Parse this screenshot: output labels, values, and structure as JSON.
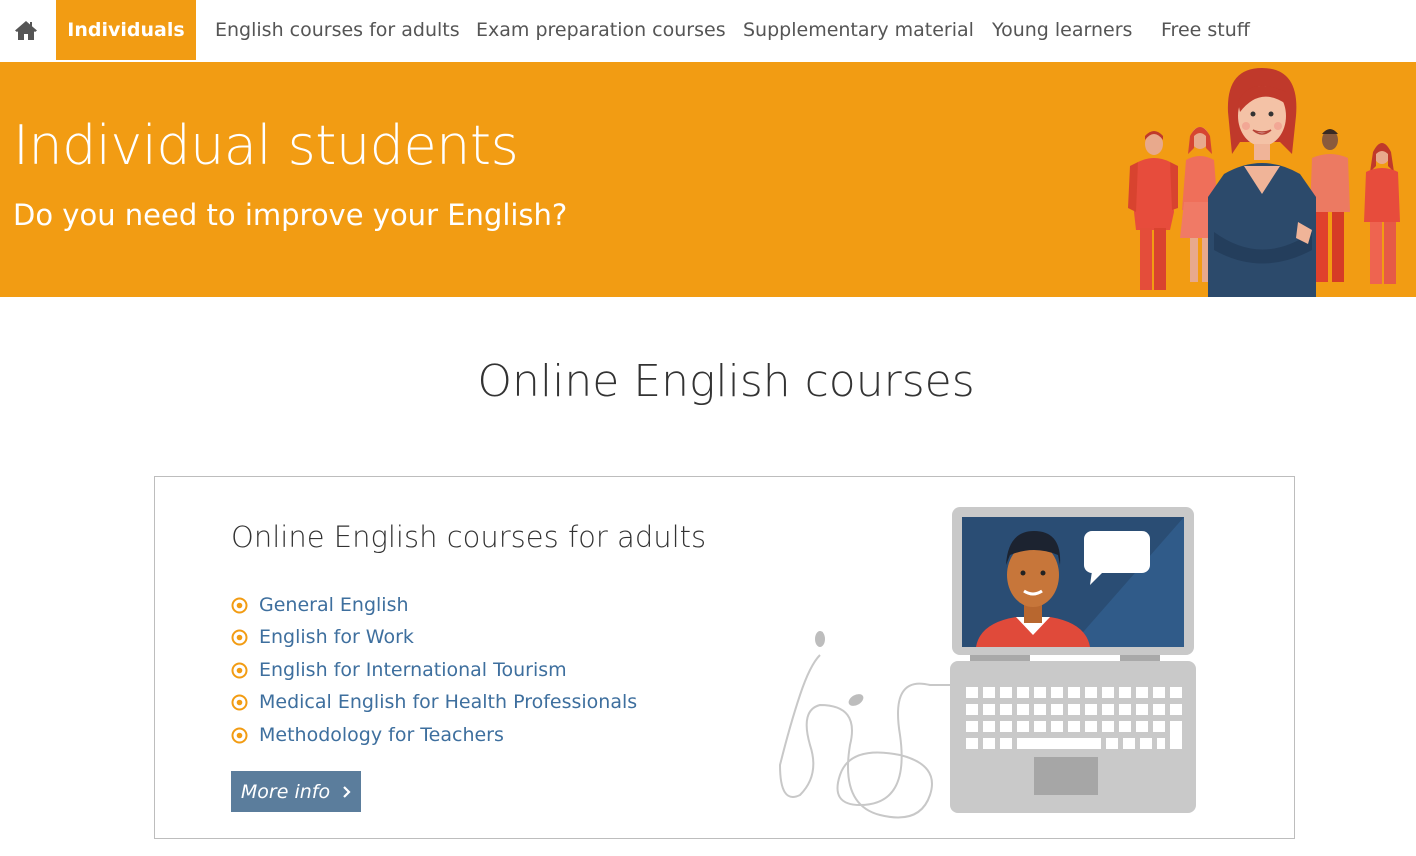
{
  "nav": {
    "home_icon": "home-icon",
    "items": [
      {
        "label": "Individuals",
        "active": true
      },
      {
        "label": "English courses for adults",
        "active": false
      },
      {
        "label": "Exam preparation courses",
        "active": false
      },
      {
        "label": "Supplementary material",
        "active": false
      },
      {
        "label": "Young learners",
        "active": false
      },
      {
        "label": "Free stuff",
        "active": false
      }
    ]
  },
  "hero": {
    "title": "Individual students",
    "subtitle": "Do you need to improve your English?"
  },
  "main": {
    "section_title": "Online English courses",
    "card": {
      "title": "Online English courses for adults",
      "courses": [
        "General English",
        "English for Work",
        "English for International Tourism",
        "Medical English for Health Professionals",
        "Methodology for Teachers"
      ],
      "button_label": "More info"
    }
  },
  "colors": {
    "accent": "#f29c13",
    "link": "#3e6f9e",
    "button": "#5b7d9c"
  }
}
